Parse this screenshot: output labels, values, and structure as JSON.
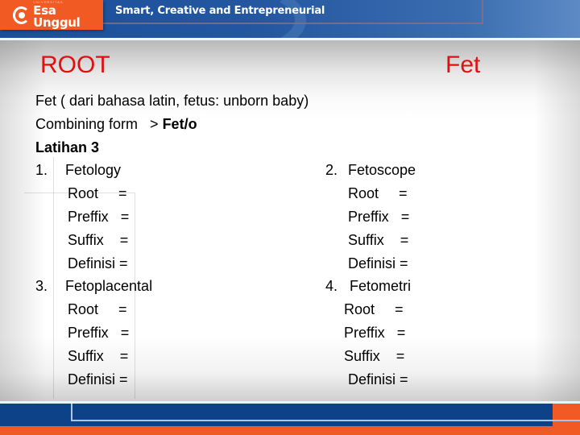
{
  "header": {
    "logo_small": "UNIVERSITAS",
    "logo_text": "Esa Unggul",
    "tagline": "Smart, Creative and Entrepreneurial",
    "colors": {
      "orange": "#f15a22",
      "blue": "#1b4f9a"
    }
  },
  "slide": {
    "title_left": "ROOT",
    "title_right": "Fet",
    "title_color": "#e01010",
    "intro": "Fet ( dari bahasa latin, fetus: unborn baby)",
    "combining_label": "Combining form   > ",
    "combining_value": "Fet/o",
    "exercise_title": "Latihan 3",
    "exercises": [
      {
        "number": "1.",
        "term": "Fetology",
        "fields": [
          "Root     =",
          "Preffix   =",
          "Suffix    =",
          "Definisi ="
        ]
      },
      {
        "number": "2.",
        "term": "Fetoscope",
        "fields": [
          "Root     =",
          "Preffix   =",
          "Suffix    =",
          "Definisi ="
        ]
      },
      {
        "number": "3.",
        "term": "Fetoplacental",
        "fields": [
          "Root     =",
          "Preffix   =",
          "Suffix    =",
          "Definisi ="
        ]
      },
      {
        "number": "4.",
        "term": "Fetometri",
        "fields": [
          "Root     =",
          "Preffix   =",
          "Suffix    =",
          "Definisi ="
        ]
      }
    ]
  }
}
